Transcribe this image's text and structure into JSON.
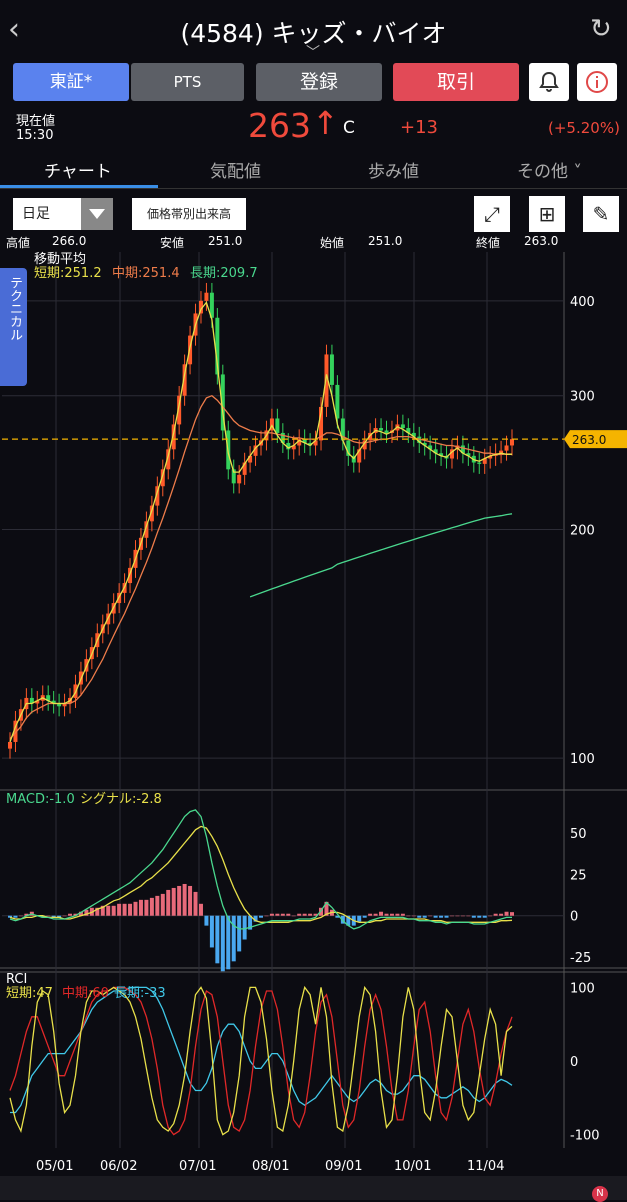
{
  "header": {
    "title": "(4584) キッズ・バイオ",
    "back_icon": "‹",
    "refresh_icon": "↻"
  },
  "buttons": {
    "exchange": "東証*",
    "pts": "PTS",
    "register": "登録",
    "trade": "取引",
    "bell_icon": "bell-icon",
    "info_icon": "info-icon"
  },
  "price": {
    "label": "現在値",
    "time": "15:30",
    "value": "263",
    "arrow": "↑",
    "suffix": "C",
    "change": "+13",
    "pct": "(+5.20%)"
  },
  "tabs": [
    "チャート",
    "気配値",
    "歩み値",
    "その他"
  ],
  "toolbar": {
    "period": "日足",
    "volume": "価格帯別出来高",
    "expand_icon": "⤢",
    "layout_icon": "⊞",
    "pen_icon": "✎"
  },
  "ohlc": {
    "high_label": "高値",
    "high": "266.0",
    "low_label": "安値",
    "low": "251.0",
    "open_label": "始値",
    "open": "251.0",
    "close_label": "終値",
    "close": "263.0"
  },
  "technical_tab": "テクニカル",
  "chart_data": [
    {
      "type": "candlestick",
      "title": "移動平均",
      "legend": [
        {
          "name": "短期",
          "value": "251.2",
          "color": "#e8e04a"
        },
        {
          "name": "中期",
          "value": "251.4",
          "color": "#ee7c4a"
        },
        {
          "name": "長期",
          "value": "209.7",
          "color": "#4ad88e"
        }
      ],
      "y_scale": "log",
      "y_ticks": [
        100,
        200,
        300,
        400
      ],
      "ylim": [
        93,
        450
      ],
      "current_price": "263.0",
      "x_labels": [
        "05/01",
        "06/02",
        "07/01",
        "08/01",
        "09/01",
        "10/01",
        "11/04"
      ],
      "closes": [
        105,
        112,
        116,
        120,
        118,
        119,
        121,
        119,
        118,
        117,
        118,
        120,
        125,
        130,
        135,
        140,
        146,
        150,
        155,
        160,
        165,
        170,
        178,
        188,
        195,
        205,
        215,
        228,
        240,
        255,
        275,
        300,
        330,
        360,
        385,
        400,
        410,
        380,
        320,
        270,
        240,
        230,
        236,
        245,
        250,
        258,
        262,
        270,
        280,
        268,
        260,
        255,
        258,
        263,
        260,
        258,
        262,
        290,
        340,
        310,
        280,
        262,
        250,
        245,
        255,
        262,
        268,
        272,
        270,
        268,
        270,
        275,
        272,
        268,
        265,
        260,
        258,
        255,
        252,
        250,
        248,
        255,
        258,
        252,
        250,
        245,
        244,
        248,
        250,
        252,
        254,
        258,
        263
      ],
      "short_ma": [
        105,
        110,
        114,
        118,
        118,
        119,
        120,
        119,
        118,
        118,
        118,
        119,
        122,
        127,
        132,
        137,
        143,
        148,
        153,
        158,
        163,
        168,
        175,
        183,
        192,
        202,
        212,
        224,
        236,
        250,
        268,
        292,
        320,
        348,
        372,
        390,
        398,
        378,
        330,
        285,
        252,
        238,
        238,
        244,
        250,
        256,
        260,
        266,
        274,
        266,
        260,
        256,
        258,
        262,
        260,
        258,
        262,
        285,
        320,
        300,
        275,
        262,
        252,
        248,
        254,
        260,
        266,
        270,
        269,
        267,
        269,
        273,
        271,
        268,
        265,
        261,
        258,
        255,
        252,
        250,
        249,
        253,
        256,
        252,
        250,
        247,
        246,
        248,
        250,
        251,
        252,
        251.2,
        251.2
      ],
      "mid_ma": [
        106,
        108,
        110,
        113,
        115,
        116,
        117,
        118,
        118,
        118,
        118,
        118,
        119,
        121,
        124,
        127,
        131,
        135,
        140,
        145,
        150,
        155,
        161,
        167,
        174,
        181,
        189,
        198,
        207,
        217,
        228,
        240,
        253,
        266,
        279,
        290,
        298,
        300,
        296,
        290,
        284,
        278,
        274,
        272,
        270,
        269,
        268,
        268,
        268,
        267,
        266,
        265,
        264,
        264,
        263,
        263,
        263,
        265,
        268,
        268,
        267,
        265,
        263,
        261,
        260,
        260,
        261,
        262,
        263,
        263,
        264,
        265,
        265,
        265,
        264,
        263,
        262,
        261,
        260,
        259,
        258,
        258,
        257,
        256,
        255,
        254,
        253,
        252,
        252,
        251,
        251,
        251.4,
        251.4
      ],
      "long_ma": [
        null,
        null,
        null,
        null,
        null,
        null,
        null,
        null,
        null,
        null,
        null,
        null,
        null,
        null,
        null,
        null,
        null,
        null,
        null,
        null,
        null,
        null,
        null,
        null,
        null,
        null,
        null,
        null,
        null,
        null,
        null,
        null,
        null,
        null,
        null,
        null,
        null,
        null,
        null,
        null,
        null,
        null,
        null,
        null,
        163,
        164,
        165,
        166,
        167,
        168,
        169,
        170,
        171,
        172,
        173,
        174,
        175,
        176,
        177,
        178,
        180,
        181,
        182,
        183,
        184,
        185,
        186,
        187,
        188,
        189,
        190,
        191,
        192,
        193,
        194,
        195,
        196,
        197,
        198,
        199,
        200,
        201,
        202,
        203,
        204,
        205,
        206,
        207,
        207.5,
        208,
        208.5,
        209.2,
        209.7
      ],
      "colors": {
        "up": "#ff5a2a",
        "down": "#34d25c",
        "price_line": "#f5b400"
      }
    },
    {
      "type": "macd",
      "legend": [
        {
          "name": "MACD",
          "value": "-1.0",
          "color": "#4ad88e"
        },
        {
          "name": "シグナル",
          "value": "-2.8",
          "color": "#e8e04a"
        }
      ],
      "y_ticks": [
        50,
        25,
        0,
        -25
      ],
      "ylim": [
        -28,
        70
      ],
      "macd": [
        -2,
        -3,
        -2,
        0,
        1,
        0,
        -1,
        -1,
        -2,
        -2,
        -2,
        -1,
        0,
        2,
        4,
        6,
        8,
        10,
        12,
        14,
        16,
        18,
        20,
        23,
        26,
        29,
        32,
        36,
        40,
        45,
        50,
        55,
        60,
        63,
        64,
        60,
        48,
        32,
        18,
        6,
        -2,
        -6,
        -8,
        -8,
        -7,
        -6,
        -5,
        -4,
        -3,
        -3,
        -3,
        -3,
        -3,
        -2,
        -2,
        -2,
        -1,
        3,
        8,
        5,
        1,
        -3,
        -6,
        -8,
        -7,
        -5,
        -3,
        -2,
        -1,
        -1,
        -1,
        -1,
        -1,
        -2,
        -2,
        -3,
        -3,
        -3,
        -4,
        -4,
        -5,
        -4,
        -4,
        -4,
        -4,
        -5,
        -5,
        -5,
        -4,
        -3,
        -2,
        -1,
        -1
      ],
      "signal": [
        -1,
        -2,
        -2,
        -1,
        -1,
        0,
        0,
        -1,
        -1,
        -1,
        -2,
        -2,
        -1,
        0,
        1,
        2,
        4,
        5,
        7,
        9,
        10,
        12,
        14,
        16,
        18,
        21,
        23,
        26,
        29,
        32,
        36,
        40,
        44,
        48,
        52,
        54,
        53,
        48,
        42,
        34,
        25,
        17,
        10,
        4,
        0,
        -3,
        -4,
        -4,
        -4,
        -4,
        -4,
        -4,
        -3,
        -3,
        -3,
        -3,
        -2,
        -1,
        1,
        2,
        2,
        1,
        -1,
        -3,
        -4,
        -4,
        -4,
        -3,
        -3,
        -2,
        -2,
        -2,
        -2,
        -2,
        -2,
        -2,
        -2,
        -3,
        -3,
        -3,
        -4,
        -4,
        -4,
        -4,
        -4,
        -4,
        -4,
        -4,
        -4,
        -4,
        -3,
        -3,
        -2.8
      ]
    },
    {
      "type": "rci",
      "title": "RCI",
      "legend": [
        {
          "name": "短期",
          "value": "47",
          "color": "#e8e04a"
        },
        {
          "name": "中期",
          "value": "60",
          "color": "#e02828"
        },
        {
          "name": "長期",
          "value": "-33",
          "color": "#40c8e8"
        }
      ],
      "y_ticks": [
        100,
        0,
        -100
      ],
      "ylim": [
        -110,
        110
      ],
      "short": [
        -50,
        -80,
        -95,
        -60,
        20,
        80,
        95,
        90,
        40,
        -30,
        -70,
        -60,
        -20,
        40,
        80,
        95,
        95,
        90,
        95,
        100,
        95,
        90,
        80,
        60,
        30,
        -10,
        -50,
        -80,
        -90,
        -95,
        -85,
        -60,
        -20,
        40,
        90,
        100,
        85,
        10,
        -80,
        -100,
        -95,
        -70,
        -20,
        60,
        100,
        100,
        80,
        30,
        -40,
        -90,
        -95,
        -60,
        0,
        70,
        100,
        90,
        50,
        100,
        60,
        -30,
        -90,
        -95,
        -60,
        0,
        60,
        100,
        90,
        40,
        -40,
        -90,
        -80,
        -20,
        60,
        100,
        70,
        -10,
        -70,
        -80,
        -40,
        20,
        70,
        60,
        0,
        -60,
        -80,
        -70,
        -20,
        30,
        70,
        50,
        -20,
        40,
        47
      ],
      "mid": [
        -40,
        -20,
        10,
        40,
        60,
        60,
        40,
        20,
        0,
        -20,
        -20,
        0,
        20,
        40,
        60,
        80,
        90,
        95,
        95,
        100,
        100,
        100,
        95,
        90,
        80,
        60,
        30,
        -10,
        -60,
        -90,
        -100,
        -95,
        -80,
        -40,
        20,
        70,
        95,
        90,
        60,
        0,
        -60,
        -90,
        -95,
        -80,
        -40,
        20,
        70,
        95,
        95,
        70,
        20,
        -40,
        -80,
        -90,
        -70,
        -20,
        40,
        80,
        90,
        60,
        0,
        -60,
        -90,
        -80,
        -40,
        20,
        70,
        90,
        70,
        20,
        -40,
        -80,
        -80,
        -40,
        20,
        70,
        80,
        40,
        -20,
        -70,
        -80,
        -50,
        0,
        50,
        70,
        40,
        -10,
        -50,
        -60,
        -30,
        10,
        40,
        60
      ],
      "long": [
        -70,
        -70,
        -60,
        -40,
        -20,
        -10,
        0,
        10,
        10,
        10,
        10,
        20,
        30,
        40,
        55,
        70,
        80,
        85,
        90,
        95,
        95,
        95,
        100,
        100,
        100,
        100,
        95,
        85,
        70,
        50,
        30,
        10,
        -10,
        -30,
        -40,
        -40,
        -30,
        -10,
        20,
        40,
        50,
        50,
        40,
        20,
        0,
        -10,
        -10,
        0,
        10,
        10,
        0,
        -20,
        -40,
        -55,
        -60,
        -55,
        -50,
        -40,
        -30,
        -20,
        -30,
        -40,
        -50,
        -55,
        -50,
        -40,
        -30,
        -25,
        -30,
        -40,
        -45,
        -45,
        -40,
        -30,
        -20,
        -20,
        -25,
        -35,
        -45,
        -50,
        -50,
        -45,
        -40,
        -35,
        -40,
        -50,
        -55,
        -50,
        -40,
        -30,
        -25,
        -28,
        -33
      ]
    }
  ]
}
